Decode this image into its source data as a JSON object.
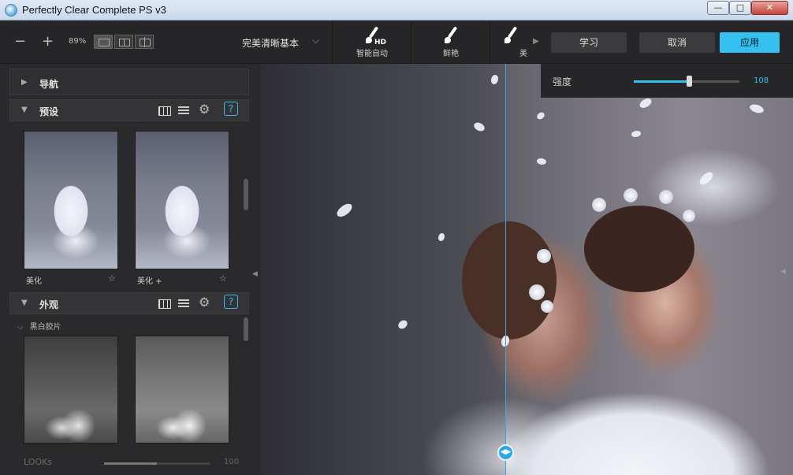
{
  "window": {
    "title": "Perfectly Clear Complete PS v3"
  },
  "toolbar": {
    "zoom_out": "−",
    "zoom_in": "+",
    "zoom_level": "89%",
    "preset_name": "完美清晰基本",
    "tools": [
      {
        "label": "智能自动",
        "badge": "HD"
      },
      {
        "label": "鲜艳"
      },
      {
        "label": "美"
      }
    ],
    "learn": "学习",
    "cancel": "取消",
    "apply": "应用"
  },
  "left_panel": {
    "nav_title": "导航",
    "presets_title": "预设",
    "presets": [
      {
        "label": "美化"
      },
      {
        "label": "美化 +"
      }
    ],
    "looks_title": "外观",
    "looks_subgroup": "黑白胶片",
    "looks_slider_label": "LOOKs",
    "looks_slider_value": "100",
    "looks_slider_fraction": 0.5
  },
  "strength": {
    "label": "强度",
    "value": "108",
    "fraction": 0.52
  },
  "icons": {
    "collapse": "▶",
    "expanded": "▼",
    "star": "☆",
    "help": "?",
    "gear": "⚙",
    "chevron_down": "⌵",
    "win_min": "—",
    "win_max": "□",
    "win_close": "✕"
  },
  "colors": {
    "accent": "#36c0ef",
    "split_line": "#38a6e0"
  }
}
